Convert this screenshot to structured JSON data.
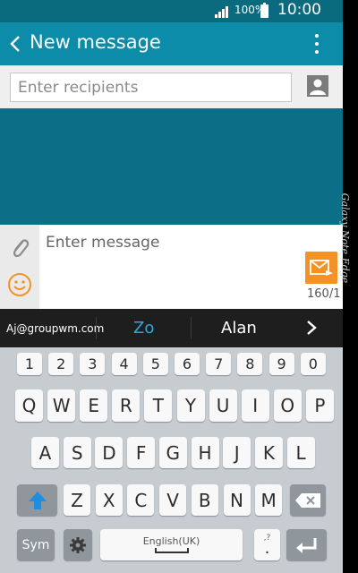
{
  "status": {
    "battery": "100%",
    "time": "10:00"
  },
  "header": {
    "title": "New message"
  },
  "recipients": {
    "placeholder": "Enter recipients"
  },
  "compose": {
    "placeholder": "Enter message",
    "counter": "160/1"
  },
  "suggestions": [
    "Aj@groupwm.com",
    "Zo",
    "Alan"
  ],
  "keyboard": {
    "numbers": [
      "1",
      "2",
      "3",
      "4",
      "5",
      "6",
      "7",
      "8",
      "9",
      "0"
    ],
    "row1": [
      "Q",
      "W",
      "E",
      "R",
      "T",
      "Y",
      "U",
      "I",
      "O",
      "P"
    ],
    "row2": [
      "A",
      "S",
      "D",
      "F",
      "G",
      "H",
      "J",
      "K",
      "L"
    ],
    "row3": [
      "Z",
      "X",
      "C",
      "V",
      "B",
      "N",
      "M"
    ],
    "sym_label": "Sym",
    "space_label": "English(UK)",
    "period_key": ".",
    "period_hint": ",?"
  },
  "device_label": "Galaxy Note Edge",
  "colors": {
    "status": "#0a6a7e",
    "actionbar": "#0c8ca8",
    "accent": "#2aa8e6",
    "send": "#f39325"
  }
}
